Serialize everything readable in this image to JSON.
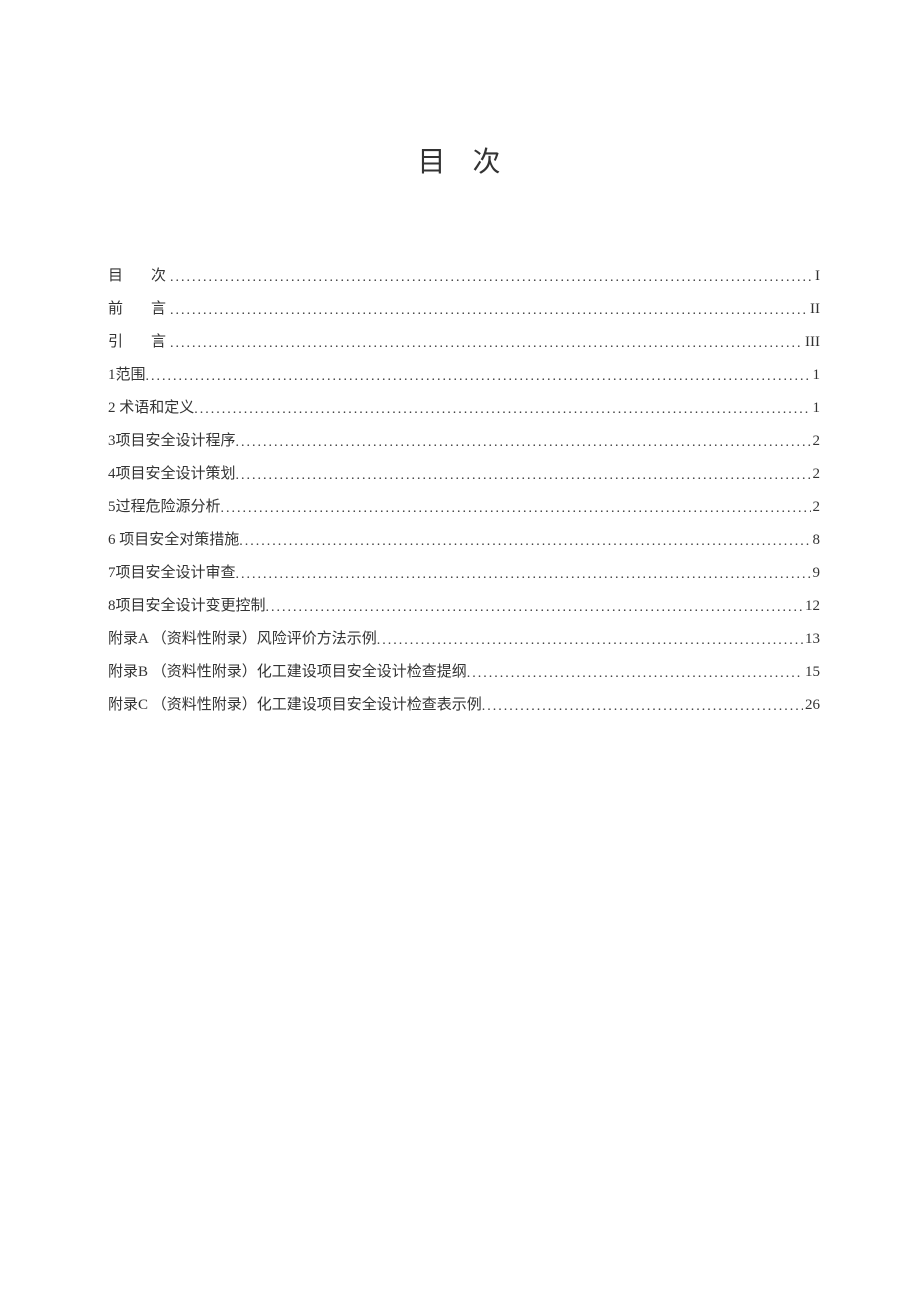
{
  "title": "目 次",
  "toc": [
    {
      "label": "目",
      "label2": "次",
      "spaced": true,
      "page": "I"
    },
    {
      "label": "前",
      "label2": "言",
      "spaced": true,
      "page": "II"
    },
    {
      "label": "引",
      "label2": "言",
      "spaced": true,
      "page": "III"
    },
    {
      "label": "1范围",
      "spaced": false,
      "page": "1"
    },
    {
      "label": "2 术语和定义",
      "spaced": false,
      "page": "1"
    },
    {
      "label": "3项目安全设计程序",
      "spaced": false,
      "page": "2"
    },
    {
      "label": "4项目安全设计策划",
      "spaced": false,
      "page": "2"
    },
    {
      "label": "5过程危险源分析",
      "spaced": false,
      "page": "2"
    },
    {
      "label": "6 项目安全对策措施",
      "spaced": false,
      "page": "8"
    },
    {
      "label": "7项目安全设计审查",
      "spaced": false,
      "page": "9"
    },
    {
      "label": "8项目安全设计变更控制",
      "spaced": false,
      "page": "12"
    },
    {
      "label": "附录A （资料性附录）风险评价方法示例",
      "spaced": false,
      "page": "13"
    },
    {
      "label": "附录B （资料性附录）化工建设项目安全设计检查提纲",
      "spaced": false,
      "page": "15"
    },
    {
      "label": "附录C （资料性附录）化工建设项目安全设计检查表示例",
      "spaced": false,
      "page": "26"
    }
  ]
}
